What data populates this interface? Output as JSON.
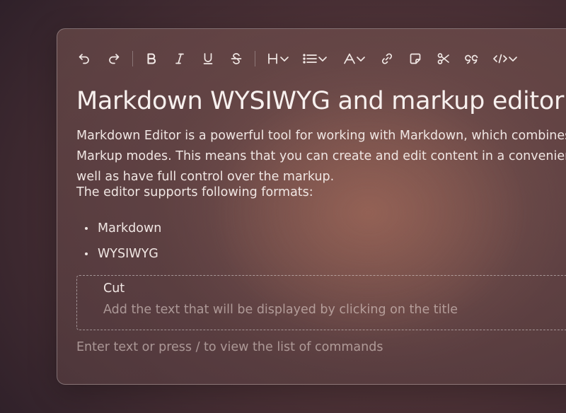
{
  "toolbar": {
    "buttons": [
      {
        "id": "undo",
        "icon": "undo-icon"
      },
      {
        "id": "redo",
        "icon": "redo-icon"
      },
      {
        "id": "bold",
        "icon": "bold-icon",
        "label": "B"
      },
      {
        "id": "italic",
        "icon": "italic-icon",
        "label": "I"
      },
      {
        "id": "underline",
        "icon": "underline-icon",
        "label": "U"
      },
      {
        "id": "strikethrough",
        "icon": "strikethrough-icon",
        "label": "S"
      },
      {
        "id": "heading",
        "icon": "heading-icon",
        "label": "H",
        "dropdown": true
      },
      {
        "id": "list",
        "icon": "bullet-list-icon",
        "dropdown": true
      },
      {
        "id": "text-color",
        "icon": "text-color-icon",
        "label": "A",
        "dropdown": true
      },
      {
        "id": "link",
        "icon": "link-icon"
      },
      {
        "id": "note",
        "icon": "note-icon"
      },
      {
        "id": "cut",
        "icon": "scissors-icon"
      },
      {
        "id": "quote",
        "icon": "quote-icon"
      },
      {
        "id": "code",
        "icon": "code-icon",
        "dropdown": true
      }
    ]
  },
  "document": {
    "title": "Markdown WYSIWYG and markup editor",
    "intro_lines": [
      "Markdown Editor is a powerful tool for working with Markdown, which combines WYSIWYG and",
      "Markup modes. This means that you can create and edit content in a convenient visual mode, as",
      "well as have full control over the markup."
    ],
    "formats_intro": "The editor supports following formats:",
    "formats": [
      "Markdown",
      "WYSIWYG"
    ],
    "cut": {
      "title": "Cut",
      "placeholder": "Add the text that will be displayed by clicking on the title"
    },
    "placeholder": "Enter text or press / to view the list of commands"
  }
}
